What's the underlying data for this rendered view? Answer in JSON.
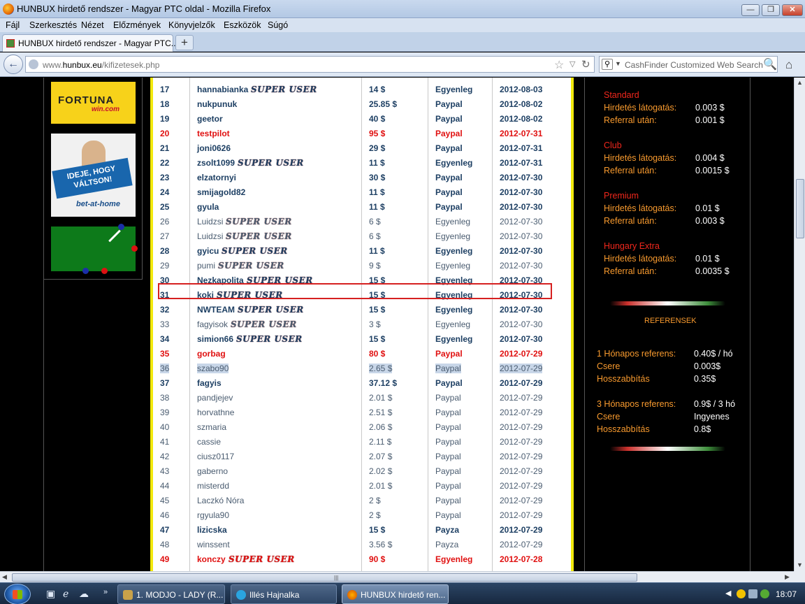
{
  "window": {
    "title": "HUNBUX hirdető rendszer - Magyar PTC oldal - Mozilla Firefox",
    "min_label": "—",
    "max_label": "❐",
    "close_label": "✕"
  },
  "menu": [
    "Fájl",
    "Szerkesztés",
    "Nézet",
    "Előzmények",
    "Könyvjelzők",
    "Eszközök",
    "Súgó"
  ],
  "tab": {
    "label": "HUNBUX hirdető rendszer - Magyar PTC...",
    "new_tab": "+"
  },
  "nav": {
    "url_prefix": "www.",
    "url_domain": "hunbux.eu",
    "url_path": "/kifizetesek.php",
    "search_placeholder": "CashFinder Customized Web Search"
  },
  "ads": {
    "fortuna_main": "FORTUNA",
    "fortuna_sub": "win.com",
    "bah_banner": "IDEJE, HOGY VÁLTSON!",
    "bah_brand": "bet-at-home"
  },
  "badge_text": "SUPER USER",
  "payouts": [
    {
      "num": "17",
      "name": "hannabianka",
      "super": true,
      "amount": "14 $",
      "method": "Egyenleg",
      "date": "2012-08-03",
      "style": "bold"
    },
    {
      "num": "18",
      "name": "nukpunuk",
      "super": false,
      "amount": "25.85 $",
      "method": "Paypal",
      "date": "2012-08-02",
      "style": "bold"
    },
    {
      "num": "19",
      "name": "geetor",
      "super": false,
      "amount": "40 $",
      "method": "Paypal",
      "date": "2012-08-02",
      "style": "bold"
    },
    {
      "num": "20",
      "name": "testpilot",
      "super": false,
      "amount": "95 $",
      "method": "Paypal",
      "date": "2012-07-31",
      "style": "red"
    },
    {
      "num": "21",
      "name": "joni0626",
      "super": false,
      "amount": "29 $",
      "method": "Paypal",
      "date": "2012-07-31",
      "style": "bold"
    },
    {
      "num": "22",
      "name": "zsolt1099",
      "super": true,
      "amount": "11 $",
      "method": "Egyenleg",
      "date": "2012-07-31",
      "style": "bold"
    },
    {
      "num": "23",
      "name": "elzatornyi",
      "super": false,
      "amount": "30 $",
      "method": "Paypal",
      "date": "2012-07-30",
      "style": "bold"
    },
    {
      "num": "24",
      "name": "smijagold82",
      "super": false,
      "amount": "11 $",
      "method": "Paypal",
      "date": "2012-07-30",
      "style": "bold"
    },
    {
      "num": "25",
      "name": "gyula",
      "super": false,
      "amount": "11 $",
      "method": "Paypal",
      "date": "2012-07-30",
      "style": "bold"
    },
    {
      "num": "26",
      "name": "Luidzsi",
      "super": true,
      "amount": "6 $",
      "method": "Egyenleg",
      "date": "2012-07-30",
      "style": "plain"
    },
    {
      "num": "27",
      "name": "Luidzsi",
      "super": true,
      "amount": "6 $",
      "method": "Egyenleg",
      "date": "2012-07-30",
      "style": "plain"
    },
    {
      "num": "28",
      "name": "gyicu",
      "super": true,
      "amount": "11 $",
      "method": "Egyenleg",
      "date": "2012-07-30",
      "style": "bold"
    },
    {
      "num": "29",
      "name": "pumi",
      "super": true,
      "amount": "9 $",
      "method": "Egyenleg",
      "date": "2012-07-30",
      "style": "plain"
    },
    {
      "num": "30",
      "name": "Nezkapolita",
      "super": true,
      "amount": "15 $",
      "method": "Egyenleg",
      "date": "2012-07-30",
      "style": "bold"
    },
    {
      "num": "31",
      "name": "koki",
      "super": true,
      "amount": "15 $",
      "method": "Egyenleg",
      "date": "2012-07-30",
      "style": "bold"
    },
    {
      "num": "32",
      "name": "NWTEAM",
      "super": true,
      "amount": "15 $",
      "method": "Egyenleg",
      "date": "2012-07-30",
      "style": "bold"
    },
    {
      "num": "33",
      "name": "fagyisok",
      "super": true,
      "amount": "3 $",
      "method": "Egyenleg",
      "date": "2012-07-30",
      "style": "plain"
    },
    {
      "num": "34",
      "name": "simion66",
      "super": true,
      "amount": "15 $",
      "method": "Egyenleg",
      "date": "2012-07-30",
      "style": "bold"
    },
    {
      "num": "35",
      "name": "gorbag",
      "super": false,
      "amount": "80 $",
      "method": "Paypal",
      "date": "2012-07-29",
      "style": "red"
    },
    {
      "num": "36",
      "name": "szabo90",
      "super": false,
      "amount": "2.65 $",
      "method": "Paypal",
      "date": "2012-07-29",
      "style": "plain hl"
    },
    {
      "num": "37",
      "name": "fagyis",
      "super": false,
      "amount": "37.12 $",
      "method": "Paypal",
      "date": "2012-07-29",
      "style": "bold"
    },
    {
      "num": "38",
      "name": "pandjejev",
      "super": false,
      "amount": "2.01 $",
      "method": "Paypal",
      "date": "2012-07-29",
      "style": "plain"
    },
    {
      "num": "39",
      "name": "horvathne",
      "super": false,
      "amount": "2.51 $",
      "method": "Paypal",
      "date": "2012-07-29",
      "style": "plain"
    },
    {
      "num": "40",
      "name": "szmaria",
      "super": false,
      "amount": "2.06 $",
      "method": "Paypal",
      "date": "2012-07-29",
      "style": "plain"
    },
    {
      "num": "41",
      "name": "cassie",
      "super": false,
      "amount": "2.11 $",
      "method": "Paypal",
      "date": "2012-07-29",
      "style": "plain"
    },
    {
      "num": "42",
      "name": "ciusz0117",
      "super": false,
      "amount": "2.07 $",
      "method": "Paypal",
      "date": "2012-07-29",
      "style": "plain"
    },
    {
      "num": "43",
      "name": "gaberno",
      "super": false,
      "amount": "2.02 $",
      "method": "Paypal",
      "date": "2012-07-29",
      "style": "plain"
    },
    {
      "num": "44",
      "name": "misterdd",
      "super": false,
      "amount": "2.01 $",
      "method": "Paypal",
      "date": "2012-07-29",
      "style": "plain"
    },
    {
      "num": "45",
      "name": "Laczkó Nóra",
      "super": false,
      "amount": "2 $",
      "method": "Paypal",
      "date": "2012-07-29",
      "style": "plain"
    },
    {
      "num": "46",
      "name": "rgyula90",
      "super": false,
      "amount": "2 $",
      "method": "Paypal",
      "date": "2012-07-29",
      "style": "plain"
    },
    {
      "num": "47",
      "name": "lizicska",
      "super": false,
      "amount": "15 $",
      "method": "Payza",
      "date": "2012-07-29",
      "style": "bold"
    },
    {
      "num": "48",
      "name": "winssent",
      "super": false,
      "amount": "3.56 $",
      "method": "Payza",
      "date": "2012-07-29",
      "style": "plain"
    },
    {
      "num": "49",
      "name": "konczy",
      "super": true,
      "amount": "90 $",
      "method": "Egyenleg",
      "date": "2012-07-28",
      "style": "red"
    }
  ],
  "membership": [
    {
      "level": "Standard",
      "visit_label": "Hirdetés látogatás:",
      "visit": "0.003 $",
      "ref_label": "Referral után:",
      "ref": "0.001 $"
    },
    {
      "level": "Club",
      "visit_label": "Hirdetés látogatás:",
      "visit": "0.004 $",
      "ref_label": "Referral után:",
      "ref": "0.0015 $"
    },
    {
      "level": "Premium",
      "visit_label": "Hirdetés látogatás:",
      "visit": "0.01 $",
      "ref_label": "Referral után:",
      "ref": "0.003 $"
    },
    {
      "level": "Hungary Extra",
      "visit_label": "Hirdetés látogatás:",
      "visit": "0.01 $",
      "ref_label": "Referral után:",
      "ref": "0.0035 $"
    }
  ],
  "referrals": {
    "heading": "REFERENSEK",
    "plans": [
      {
        "label": "1 Hónapos referens:",
        "price": "0.40$ / hó",
        "swap_label": "Csere",
        "swap": "0.003$",
        "ext_label": "Hosszabbítás",
        "ext": "0.35$"
      },
      {
        "label": "3 Hónapos referens:",
        "price": "0.9$ / 3 hó",
        "swap_label": "Csere",
        "swap": "Ingyenes",
        "ext_label": "Hosszabbítás",
        "ext": "0.8$"
      }
    ]
  },
  "taskbar": {
    "tasks": [
      "1. MODJO - LADY (R...",
      "Illés Hajnalka",
      "HUNBUX hirdető ren..."
    ],
    "clock": "18:07"
  }
}
